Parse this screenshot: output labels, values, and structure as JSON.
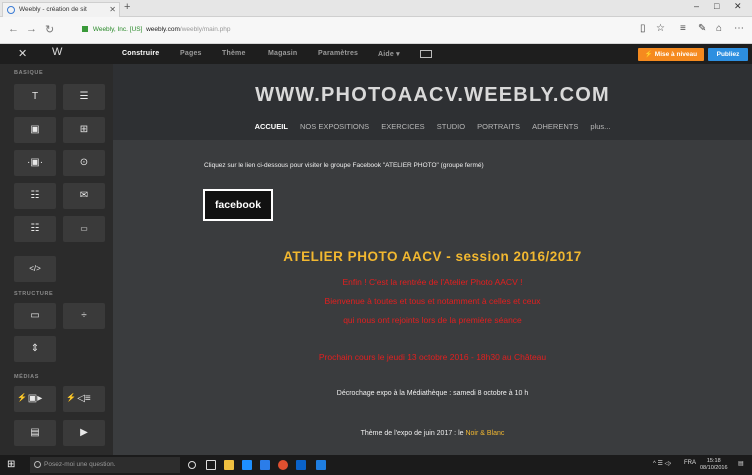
{
  "browser": {
    "tab_title": "Weebly - création de sit",
    "new_tab": "+",
    "address": {
      "cert": "Weebly, Inc. [US]",
      "host": "weebly.com",
      "path": "/weebly/main.php"
    },
    "window_controls": [
      "–",
      "□",
      "✕"
    ]
  },
  "editor": {
    "menu": [
      "Construire",
      "Pages",
      "Thème",
      "Magasin",
      "Paramètres",
      "Aide ▾"
    ],
    "upgrade_label": "⚡ Mise à niveau",
    "publish_label": "Publiez",
    "sidebar": {
      "sections": {
        "basic": "BASIQUE",
        "structure": "STRUCTURE",
        "media": "MÉDIAS"
      }
    }
  },
  "site": {
    "title": "WWW.PHOTOAACV.WEEBLY.COM",
    "nav": [
      "ACCUEIL",
      "NOS EXPOSITIONS",
      "EXERCICES",
      "STUDIO",
      "PORTRAITS",
      "ADHERENTS",
      "plus..."
    ],
    "intro": "Cliquez sur le lien ci-dessous pour visiter le groupe Facebook \"ATELIER PHOTO\" (groupe fermé)",
    "facebook_label": "facebook",
    "heading": "ATELIER PHOTO AACV - session 2016/2017",
    "red_lines": [
      "Enfin ! C'est la rentrée de l'Atelier Photo AACV !",
      "Bienvenue à toutes et tous et notamment à celles et ceux",
      "qui nous ont rejoints lors de la première séance",
      "Prochain cours le jeudi 13 octobre 2016 - 18h30 au Château"
    ],
    "expo_line": "Décrochage expo à la Médiathèque : samedi 8 octobre à 10 h",
    "theme_prefix": "Thème de l'expo de juin 2017 : le",
    "theme_highlight": "Noir & Blanc"
  },
  "taskbar": {
    "search_placeholder": "Posez-moi une question.",
    "lang": "FRA",
    "time": "15:18",
    "date": "08/10/2016"
  }
}
